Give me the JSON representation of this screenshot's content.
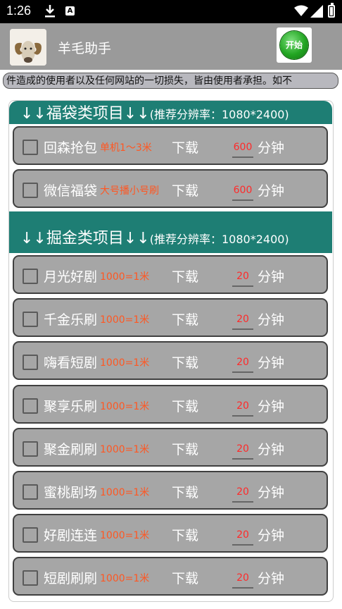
{
  "status_bar": {
    "time": "1:26",
    "notif_a": "A"
  },
  "app": {
    "title": "羊毛助手",
    "start_label": "开始"
  },
  "marquee_text": "件造成的使用者以及任何网站的一切损失，皆由使用者承担。如不",
  "sections": [
    {
      "title": "↓↓福袋类项目↓↓",
      "note": "(推荐分辨率：1080*2400)"
    },
    {
      "title": "↓↓掘金类项目↓↓",
      "note": "(推荐分辨率：1080*2400)"
    }
  ],
  "download_label": "下载",
  "unit_label": "分钟",
  "items": [
    {
      "name": "回森抢包",
      "tag": "单机1～3米",
      "minutes": "600"
    },
    {
      "name": "微信福袋",
      "tag": "大号播小号刷",
      "minutes": "600"
    },
    {
      "name": "月光好剧",
      "tag": "1000=1米",
      "minutes": "20"
    },
    {
      "name": "千金乐刷",
      "tag": "1000=1米",
      "minutes": "20"
    },
    {
      "name": "嗨看短剧",
      "tag": "1000=1米",
      "minutes": "20"
    },
    {
      "name": "聚享乐刷",
      "tag": "1000=1米",
      "minutes": "20"
    },
    {
      "name": "聚金刷刷",
      "tag": "1000=1米",
      "minutes": "20"
    },
    {
      "name": "蜜桃剧场",
      "tag": "1000=1米",
      "minutes": "20"
    },
    {
      "name": "好剧连连",
      "tag": "1000=1米",
      "minutes": "20"
    },
    {
      "name": "短剧刷刷",
      "tag": "1000=1米",
      "minutes": "20"
    }
  ],
  "colors": {
    "section_header": "#1e7e74",
    "row_bg": "#a6a6a6",
    "tag": "#ff5722",
    "minutes": "#ff2a2a",
    "appbar": "#9a9a9a"
  }
}
